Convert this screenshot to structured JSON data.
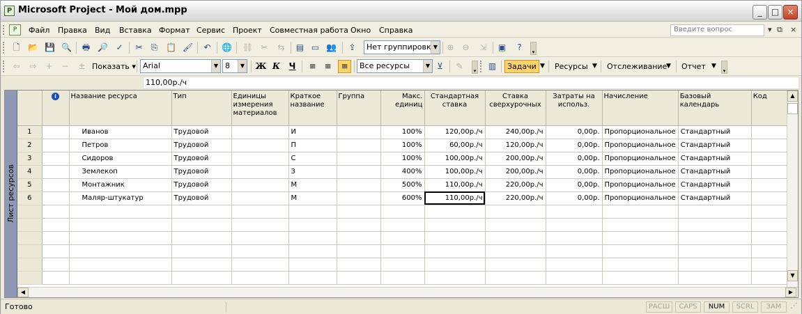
{
  "window": {
    "title": "Microsoft Project - Мой дом.mpp",
    "controls": [
      "_",
      "□",
      "×"
    ]
  },
  "menu": {
    "items": [
      "Файл",
      "Правка",
      "Вид",
      "Вставка",
      "Формат",
      "Сервис",
      "Проект",
      "Совместная работа",
      "Окно",
      "Справка"
    ],
    "help_placeholder": "Введите вопрос"
  },
  "toolbar1": {
    "grouping": "Нет группировки"
  },
  "toolbar2": {
    "show_label": "Показать",
    "font": "Arial",
    "font_size": "8",
    "filter": "Все ресурсы",
    "tasks": "Задачи",
    "resources": "Ресурсы",
    "tracking": "Отслеживание",
    "report": "Отчет",
    "bold": "Ж",
    "italic": "К",
    "underline": "Ч"
  },
  "entry_bar": {
    "value": "110,00р./ч"
  },
  "view_bar": {
    "label": "Лист ресурсов"
  },
  "columns": [
    "Название ресурса",
    "Тип",
    "Единицы измерения материалов",
    "Краткое название",
    "Группа",
    "Макс. единиц",
    "Стандартная ставка",
    "Ставка сверхурочных",
    "Затраты на использ.",
    "Начисление",
    "Базовый календарь",
    "Код"
  ],
  "rows": [
    {
      "id": "1",
      "name": "Иванов",
      "type": "Трудовой",
      "units": "",
      "short": "И",
      "group": "",
      "max": "100%",
      "std": "120,00р./ч",
      "ovt": "240,00р./ч",
      "cost": "0,00р.",
      "accrue": "Пропорциональное",
      "calendar": "Стандартный",
      "code": ""
    },
    {
      "id": "2",
      "name": "Петров",
      "type": "Трудовой",
      "units": "",
      "short": "П",
      "group": "",
      "max": "100%",
      "std": "60,00р./ч",
      "ovt": "120,00р./ч",
      "cost": "0,00р.",
      "accrue": "Пропорциональное",
      "calendar": "Стандартный",
      "code": ""
    },
    {
      "id": "3",
      "name": "Сидоров",
      "type": "Трудовой",
      "units": "",
      "short": "С",
      "group": "",
      "max": "100%",
      "std": "100,00р./ч",
      "ovt": "200,00р./ч",
      "cost": "0,00р.",
      "accrue": "Пропорциональное",
      "calendar": "Стандартный",
      "code": ""
    },
    {
      "id": "4",
      "name": "Землекоп",
      "type": "Трудовой",
      "units": "",
      "short": "З",
      "group": "",
      "max": "400%",
      "std": "100,00р./ч",
      "ovt": "200,00р./ч",
      "cost": "0,00р.",
      "accrue": "Пропорциональное",
      "calendar": "Стандартный",
      "code": ""
    },
    {
      "id": "5",
      "name": "Монтажник",
      "type": "Трудовой",
      "units": "",
      "short": "М",
      "group": "",
      "max": "500%",
      "std": "110,00р./ч",
      "ovt": "220,00р./ч",
      "cost": "0,00р.",
      "accrue": "Пропорциональное",
      "calendar": "Стандартный",
      "code": ""
    },
    {
      "id": "6",
      "name": "Маляр-штукатур",
      "type": "Трудовой",
      "units": "",
      "short": "М",
      "group": "",
      "max": "600%",
      "std": "110,00р./ч",
      "ovt": "220,00р./ч",
      "cost": "0,00р.",
      "accrue": "Пропорциональное",
      "calendar": "Стандартный",
      "code": ""
    }
  ],
  "status": {
    "text": "Готово",
    "indicators": [
      "РАСШ",
      "CAPS",
      "NUM",
      "SCRL",
      "ЗАМ"
    ]
  }
}
